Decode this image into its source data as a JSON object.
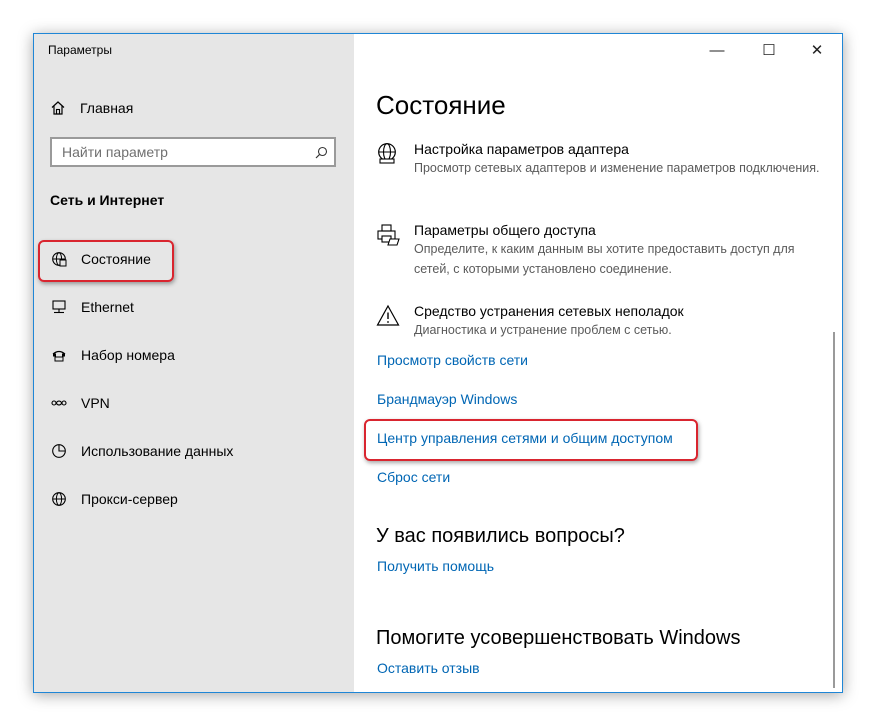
{
  "window": {
    "title": "Параметры",
    "minimize_glyph": "—",
    "maximize_glyph": "☐",
    "close_glyph": "✕"
  },
  "sidebar": {
    "home_label": "Главная",
    "search_placeholder": "Найти параметр",
    "section_title": "Сеть и Интернет",
    "items": [
      {
        "label": "Состояние",
        "icon": "globe-status-icon",
        "selected": true
      },
      {
        "label": "Ethernet",
        "icon": "ethernet-icon"
      },
      {
        "label": "Набор номера",
        "icon": "dialup-icon"
      },
      {
        "label": "VPN",
        "icon": "vpn-icon"
      },
      {
        "label": "Использование данных",
        "icon": "data-usage-icon"
      },
      {
        "label": "Прокси-сервер",
        "icon": "globe-icon"
      }
    ]
  },
  "main": {
    "title": "Состояние",
    "settings": [
      {
        "title": "Настройка параметров адаптера",
        "desc": "Просмотр сетевых адаптеров и изменение параметров подключения.",
        "icon": "adapter-globe-icon"
      },
      {
        "title": "Параметры общего доступа",
        "desc": "Определите, к каким данным вы хотите предоставить доступ для сетей, с которыми установлено соединение.",
        "icon": "sharing-printer-icon"
      },
      {
        "title": "Средство устранения сетевых неполадок",
        "desc": "Диагностика и устранение проблем с сетью.",
        "icon": "warning-icon"
      }
    ],
    "links": [
      "Просмотр свойств сети",
      "Брандмауэр Windows",
      "Центр управления сетями и общим доступом",
      "Сброс сети"
    ],
    "questions_title": "У вас появились вопросы?",
    "help_link": "Получить помощь",
    "improve_title": "Помогите усовершенствовать Windows",
    "feedback_link": "Оставить отзыв"
  },
  "highlight_color": "#d9252f",
  "link_color": "#0066b4"
}
